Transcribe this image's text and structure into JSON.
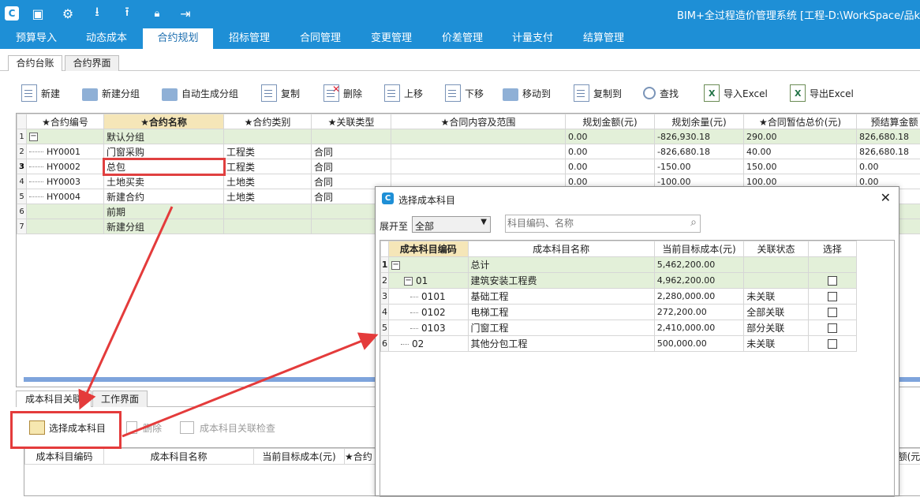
{
  "window": {
    "title": "BIM+全过程造价管理系统 [工程-D:\\WorkSpace/品k"
  },
  "quick_access": [
    "app-logo-icon",
    "save-icon",
    "settings-icon",
    "download-icon",
    "upload-icon",
    "lock-icon",
    "exit-icon"
  ],
  "menu": [
    "预算导入",
    "动态成本",
    "合约规划",
    "招标管理",
    "合同管理",
    "变更管理",
    "价差管理",
    "计量支付",
    "结算管理"
  ],
  "menu_active": "合约规划",
  "subtabs": [
    "合约台账",
    "合约界面"
  ],
  "toolbar": [
    "新建",
    "新建分组",
    "自动生成分组",
    "复制",
    "删除",
    "上移",
    "下移",
    "移动到",
    "复制到",
    "查找",
    "导入Excel",
    "导出Excel"
  ],
  "contract_table": {
    "headers": [
      "★合约编号",
      "★合约名称",
      "★合约类别",
      "★关联类型",
      "★合同内容及范围",
      "规划金额(元)",
      "规划余量(元)",
      "★合同暂估总价(元)",
      "预结算金额"
    ],
    "rows": [
      {
        "rn": "1",
        "code": "",
        "name": "默认分组",
        "cat": "",
        "rel": "",
        "scope": "",
        "amount": "0.00",
        "remain": "-826,930.18",
        "est": "290.00",
        "settle": "826,680.18",
        "group": true
      },
      {
        "rn": "2",
        "code": "HY0001",
        "name": "门窗采购",
        "cat": "工程类",
        "rel": "合同",
        "scope": "",
        "amount": "0.00",
        "remain": "-826,680.18",
        "est": "40.00",
        "settle": "826,680.18"
      },
      {
        "rn": "3",
        "code": "HY0002",
        "name": "总包",
        "cat": "工程类",
        "rel": "合同",
        "scope": "",
        "amount": "0.00",
        "remain": "-150.00",
        "est": "150.00",
        "settle": "0.00"
      },
      {
        "rn": "4",
        "code": "HY0003",
        "name": "土地买卖",
        "cat": "土地类",
        "rel": "合同",
        "scope": "",
        "amount": "0.00",
        "remain": "-100.00",
        "est": "100.00",
        "settle": "0.00"
      },
      {
        "rn": "5",
        "code": "HY0004",
        "name": "新建合约",
        "cat": "土地类",
        "rel": "合同",
        "scope": "",
        "amount": "",
        "remain": "",
        "est": "",
        "settle": ""
      },
      {
        "rn": "6",
        "code": "",
        "name": "前期",
        "cat": "",
        "rel": "",
        "scope": "",
        "amount": "",
        "remain": "",
        "est": "",
        "settle": "",
        "group": true
      },
      {
        "rn": "7",
        "code": "",
        "name": "新建分组",
        "cat": "",
        "rel": "",
        "scope": "",
        "amount": "",
        "remain": "",
        "est": "",
        "settle": "",
        "group": true
      }
    ]
  },
  "bottom_tabs": [
    "成本科目关联",
    "工作界面"
  ],
  "bottom_toolbar": {
    "select": "选择成本科目",
    "delete": "删除",
    "check": "成本科目关联检查"
  },
  "bottom_table": {
    "headers": [
      "成本科目编码",
      "成本科目名称",
      "当前目标成本(元)",
      "★合约",
      "额(元)"
    ]
  },
  "dialog": {
    "title": "选择成本科目",
    "expand_label": "展开至",
    "expand_value": "全部",
    "search_placeholder": "科目编码、名称",
    "headers": [
      "成本科目编码",
      "成本科目名称",
      "当前目标成本(元)",
      "关联状态",
      "选择"
    ],
    "rows": [
      {
        "rn": "1",
        "code": "",
        "name": "总计",
        "cost": "5,462,200.00",
        "status": "",
        "checkbox": false,
        "level": 0,
        "group": true
      },
      {
        "rn": "2",
        "code": "01",
        "name": "建筑安装工程费",
        "cost": "4,962,200.00",
        "status": "",
        "checkbox": true,
        "level": 1,
        "group": true
      },
      {
        "rn": "3",
        "code": "0101",
        "name": "基础工程",
        "cost": "2,280,000.00",
        "status": "未关联",
        "checkbox": true,
        "level": 2
      },
      {
        "rn": "4",
        "code": "0102",
        "name": "电梯工程",
        "cost": "272,200.00",
        "status": "全部关联",
        "checkbox": true,
        "level": 2
      },
      {
        "rn": "5",
        "code": "0103",
        "name": "门窗工程",
        "cost": "2,410,000.00",
        "status": "部分关联",
        "checkbox": true,
        "level": 2
      },
      {
        "rn": "6",
        "code": "02",
        "name": "其他分包工程",
        "cost": "500,000.00",
        "status": "未关联",
        "checkbox": true,
        "level": 1
      }
    ]
  }
}
